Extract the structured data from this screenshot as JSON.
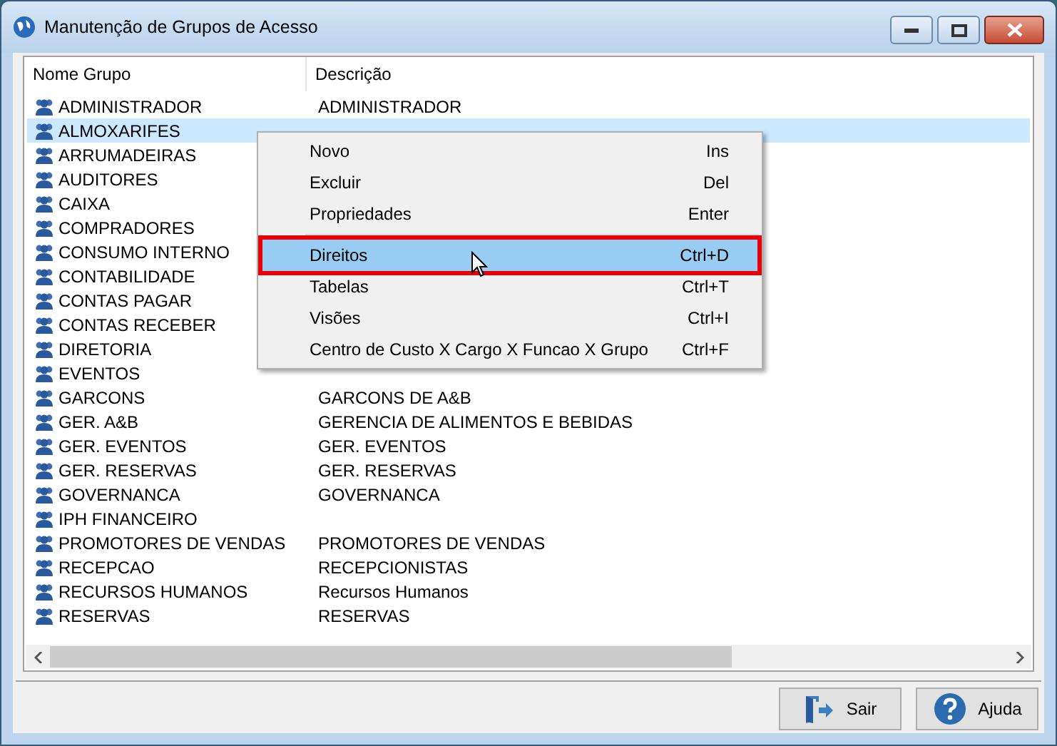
{
  "window": {
    "title": "Manutenção de Grupos de Acesso"
  },
  "table": {
    "columns": [
      "Nome Grupo",
      "Descrição"
    ],
    "rows": [
      {
        "name": "ADMINISTRADOR",
        "description": "ADMINISTRADOR",
        "selected": false
      },
      {
        "name": "ALMOXARIFES",
        "selected": true
      },
      {
        "name": "ARRUMADEIRAS",
        "selected": false
      },
      {
        "name": "AUDITORES",
        "selected": false
      },
      {
        "name": "CAIXA",
        "selected": false
      },
      {
        "name": "COMPRADORES",
        "selected": false
      },
      {
        "name": "CONSUMO INTERNO",
        "selected": false
      },
      {
        "name": "CONTABILIDADE",
        "selected": false
      },
      {
        "name": "CONTAS PAGAR",
        "selected": false
      },
      {
        "name": "CONTAS RECEBER",
        "selected": false
      },
      {
        "name": "DIRETORIA",
        "selected": false
      },
      {
        "name": "EVENTOS",
        "selected": false
      },
      {
        "name": "GARCONS",
        "description": "GARCONS DE A&B",
        "selected": false
      },
      {
        "name": "GER. A&B",
        "description": "GERENCIA DE ALIMENTOS E BEBIDAS",
        "selected": false
      },
      {
        "name": "GER. EVENTOS",
        "description": "GER. EVENTOS",
        "selected": false
      },
      {
        "name": "GER. RESERVAS",
        "description": "GER. RESERVAS",
        "selected": false
      },
      {
        "name": "GOVERNANCA",
        "description": "GOVERNANCA",
        "selected": false
      },
      {
        "name": "IPH FINANCEIRO",
        "selected": false
      },
      {
        "name": "PROMOTORES DE VENDAS",
        "description": "PROMOTORES DE VENDAS",
        "selected": false
      },
      {
        "name": "RECEPCAO",
        "description": "RECEPCIONISTAS",
        "selected": false
      },
      {
        "name": "RECURSOS HUMANOS",
        "description": "Recursos Humanos",
        "selected": false
      },
      {
        "name": "RESERVAS",
        "description": "RESERVAS",
        "selected": false
      }
    ]
  },
  "context_menu": {
    "items": [
      {
        "kind": "item",
        "label": "Novo",
        "shortcut": "Ins",
        "selected": false,
        "annotated": false
      },
      {
        "kind": "item",
        "label": "Excluir",
        "shortcut": "Del",
        "selected": false,
        "annotated": false
      },
      {
        "kind": "item",
        "label": "Propriedades",
        "shortcut": "Enter",
        "selected": false,
        "annotated": false
      },
      {
        "kind": "separator"
      },
      {
        "kind": "item",
        "label": "Direitos",
        "shortcut": "Ctrl+D",
        "selected": true,
        "annotated": true
      },
      {
        "kind": "item",
        "label": "Tabelas",
        "shortcut": "Ctrl+T",
        "selected": false,
        "annotated": false
      },
      {
        "kind": "item",
        "label": "Visões",
        "shortcut": "Ctrl+I",
        "selected": false,
        "annotated": false
      },
      {
        "kind": "item",
        "label": "Centro de Custo X Cargo X Funcao X Grupo",
        "shortcut": "Ctrl+F",
        "selected": false,
        "annotated": false
      }
    ]
  },
  "buttons": [
    {
      "kind": "exit",
      "label": "Sair"
    },
    {
      "kind": "help",
      "label": "Ajuda"
    }
  ]
}
